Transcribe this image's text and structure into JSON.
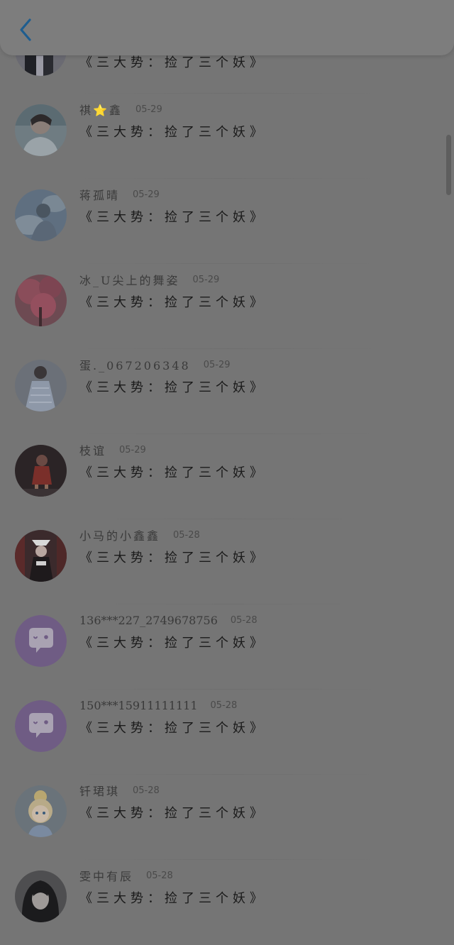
{
  "header": {
    "back_icon": "chevron-left-icon"
  },
  "comment_text": "《三大势：捡了三个妖》",
  "comments": [
    {
      "username": "",
      "date": "",
      "comment": "《三大势：捡了三个妖》",
      "avatar": "photo-dark"
    },
    {
      "username": "祺⭐鑫",
      "date": "05-29",
      "comment": "《三大势：捡了三个妖》",
      "avatar": "photo-boy"
    },
    {
      "username": "蒋孤晴",
      "date": "05-29",
      "comment": "《三大势：捡了三个妖》",
      "avatar": "photo-blue-sky"
    },
    {
      "username": "冰_U尖上的舞姿",
      "date": "05-29",
      "comment": "《三大势：捡了三个妖》",
      "avatar": "photo-pink-tree"
    },
    {
      "username": "蛋._067206348",
      "date": "05-29",
      "comment": "《三大势：捡了三个妖》",
      "avatar": "photo-girl-dress"
    },
    {
      "username": "枝谊",
      "date": "05-29",
      "comment": "《三大势：捡了三个妖》",
      "avatar": "photo-dancer"
    },
    {
      "username": "小马的小鑫鑫",
      "date": "05-28",
      "comment": "《三大势：捡了三个妖》",
      "avatar": "photo-costume"
    },
    {
      "username": "136***227_2749678756",
      "date": "05-28",
      "comment": "《三大势：捡了三个妖》",
      "avatar": "default-chat-bubble"
    },
    {
      "username": "150***15911111111",
      "date": "05-28",
      "comment": "《三大势：捡了三个妖》",
      "avatar": "default-chat-bubble"
    },
    {
      "username": "钎珺琪",
      "date": "05-28",
      "comment": "《三大势：捡了三个妖》",
      "avatar": "cartoon-girl"
    },
    {
      "username": "雯中有辰",
      "date": "05-28",
      "comment": "《三大势：捡了三个妖》",
      "avatar": "photo-black-hair"
    }
  ],
  "colors": {
    "overlay_background": "#757575",
    "back_icon": "#1e5d8f",
    "default_avatar": "#6f5c84"
  }
}
